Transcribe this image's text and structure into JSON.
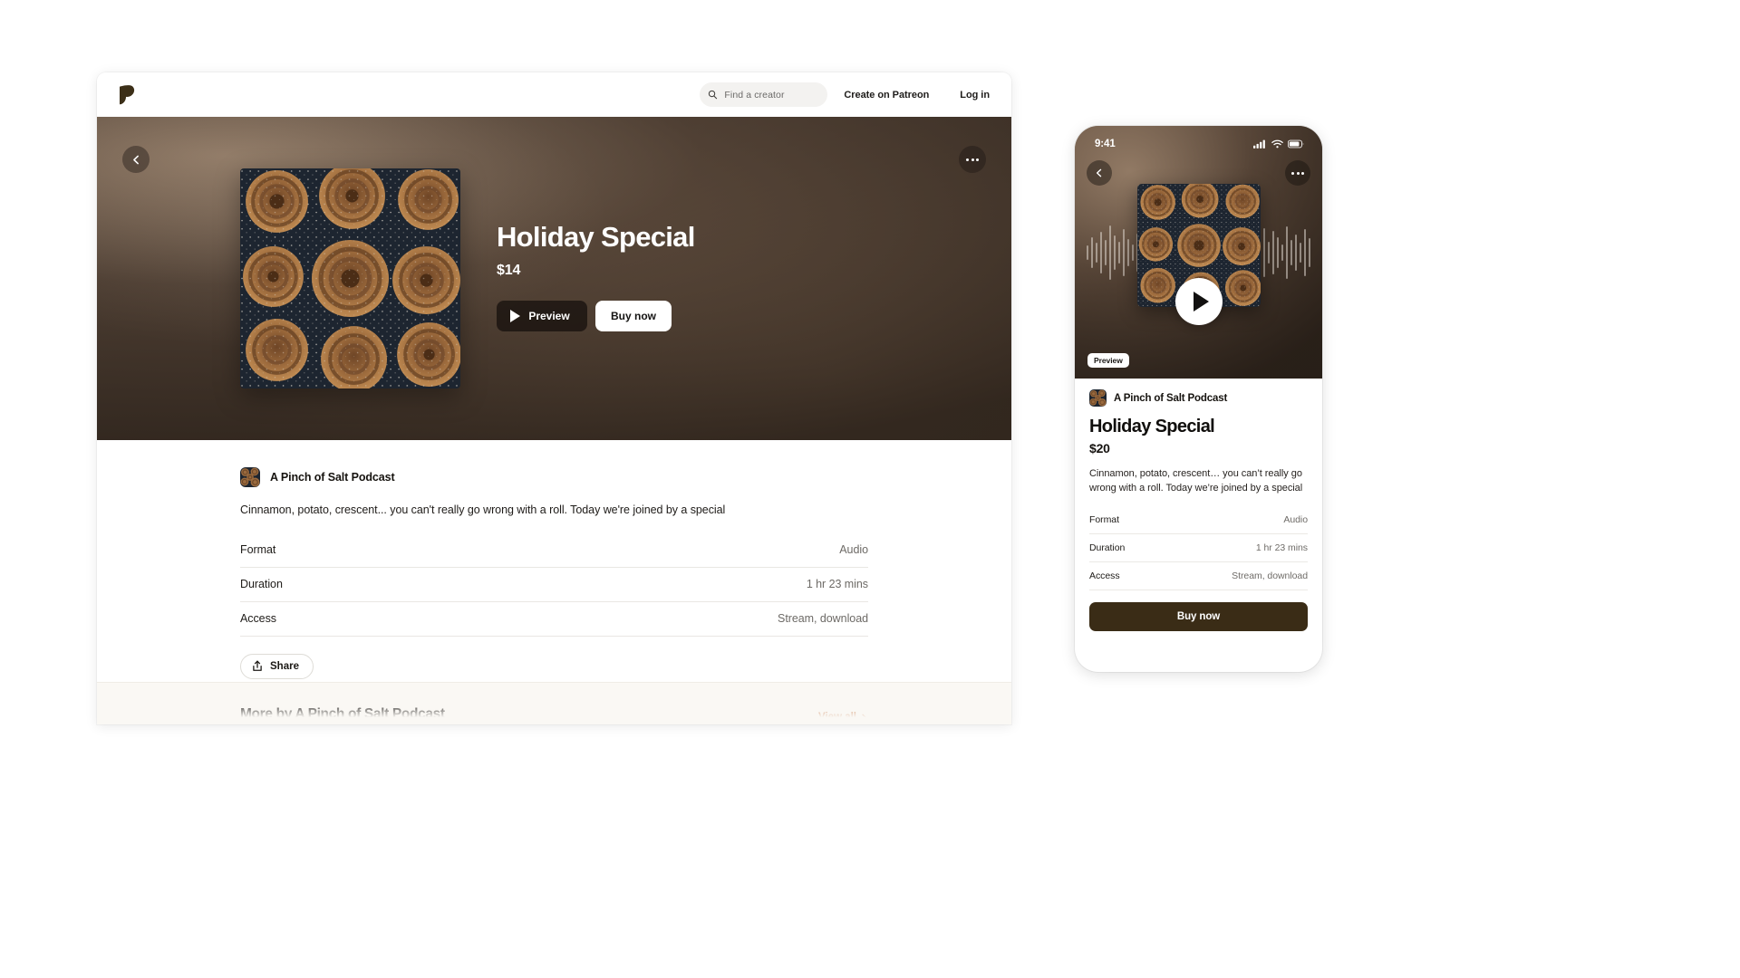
{
  "colors": {
    "brand": "#3a2c16",
    "accent_link": "#bf6730",
    "page_bg": "#ffffff",
    "strip_bg": "#faf8f4",
    "hero_dark": "#2b211a"
  },
  "desktop": {
    "header": {
      "logo_icon": "patreon-p-logo",
      "search": {
        "icon": "search-icon",
        "placeholder": "Find a creator",
        "value": "Find a creator"
      },
      "create_label": "Create on Patreon",
      "login_label": "Log in"
    },
    "hero": {
      "back_icon": "chevron-left-icon",
      "more_icon": "ellipsis-icon",
      "artwork_alt": "cinnamon-rolls-artwork",
      "title": "Holiday Special",
      "price": "$14",
      "preview_button": "Preview",
      "preview_icon": "play-icon",
      "buy_button": "Buy now"
    },
    "details": {
      "creator_name": "A Pinch of Salt Podcast",
      "description": "Cinnamon, potato, crescent... you can't really go wrong with a roll. Today we're joined by a special",
      "meta": [
        {
          "key": "Format",
          "value": "Audio"
        },
        {
          "key": "Duration",
          "value": "1 hr 23 mins"
        },
        {
          "key": "Access",
          "value": "Stream, download"
        }
      ],
      "share_button": "Share",
      "share_icon": "share-upload-icon"
    },
    "more_section": {
      "title": "More by A Pinch of Salt Podcast",
      "view_all": "View all",
      "view_all_icon": "chevron-right-icon"
    }
  },
  "phone": {
    "status_bar": {
      "time": "9:41",
      "cellular_icon": "signal-bars-icon",
      "wifi_icon": "wifi-icon",
      "battery_icon": "battery-icon"
    },
    "hero": {
      "back_icon": "chevron-left-icon",
      "more_icon": "ellipsis-icon",
      "artwork_alt": "cinnamon-rolls-artwork",
      "play_icon": "play-icon",
      "preview_badge": "Preview"
    },
    "details": {
      "creator_name": "A Pinch of Salt Podcast",
      "title": "Holiday Special",
      "price": "$20",
      "description": "Cinnamon, potato, crescent… you can’t really go wrong with a roll. Today we’re joined by a special",
      "meta": [
        {
          "key": "Format",
          "value": "Audio"
        },
        {
          "key": "Duration",
          "value": "1 hr 23 mins"
        },
        {
          "key": "Access",
          "value": "Stream, download"
        }
      ],
      "buy_button": "Buy now"
    }
  }
}
